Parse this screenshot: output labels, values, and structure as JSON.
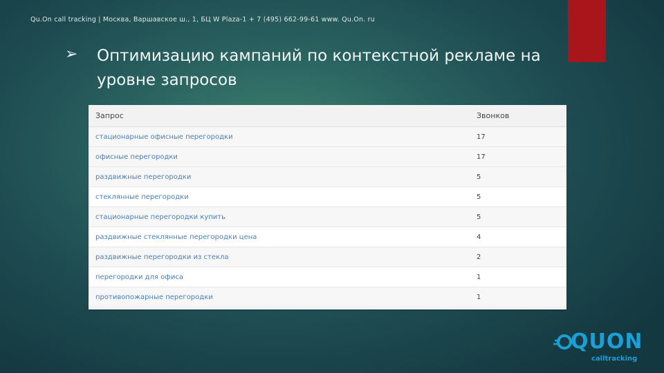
{
  "header": {
    "text": "Qu.On call tracking   |   Москва, Варшавское ш., 1, БЦ W Plaza-1 + 7  (495) 662-99-61 www. Qu.On. ru"
  },
  "slide": {
    "bullet": "➢",
    "title": "Оптимизацию кампаний по контекстной рекламе на уровне запросов"
  },
  "table": {
    "columns": [
      "Запрос",
      "Звонков"
    ],
    "rows": [
      {
        "query": "стационарные офисные перегородки",
        "calls": "17"
      },
      {
        "query": "офисные перегородки",
        "calls": "17"
      },
      {
        "query": "раздвижные перегородки",
        "calls": "5"
      },
      {
        "query": "стеклянные перегородки",
        "calls": "5"
      },
      {
        "query": "стационарные перегородки купить",
        "calls": "5"
      },
      {
        "query": "раздвижные стеклянные перегородки цена",
        "calls": "4"
      },
      {
        "query": "раздвижные перегородки из стекла",
        "calls": "2"
      },
      {
        "query": "перегородки для офиса",
        "calls": "1"
      },
      {
        "query": "противопожарные перегородки",
        "calls": "1"
      }
    ]
  },
  "logo": {
    "text": "QUON",
    "subtitle": "calltracking",
    "color": "#1c9fd6"
  },
  "colors": {
    "accent_red": "#a8161b",
    "link_blue": "#4a7fb5"
  }
}
